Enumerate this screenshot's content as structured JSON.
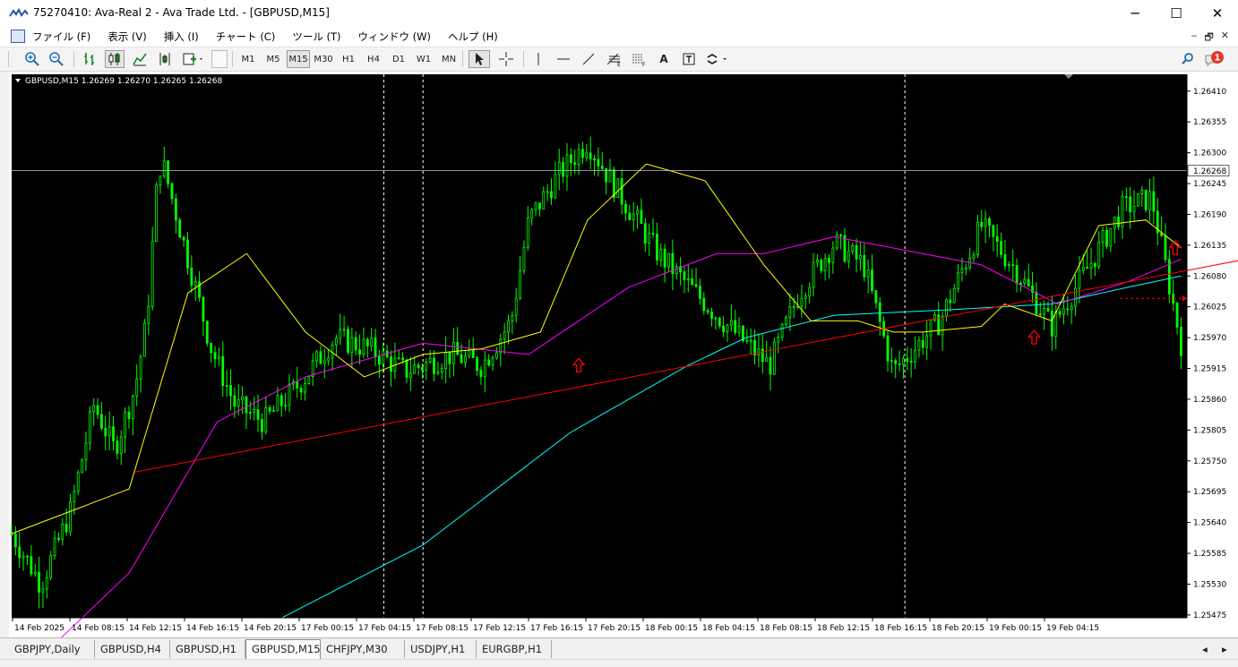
{
  "window": {
    "title": "75270410: Ava-Real 2 - Ava Trade Ltd. - [GBPUSD,M15]",
    "minimize_glyph": "─",
    "maximize_glyph": "☐",
    "close_glyph": "✕"
  },
  "menu": {
    "items": [
      "ファイル (F)",
      "表示 (V)",
      "挿入 (I)",
      "チャート (C)",
      "ツール (T)",
      "ウィンドウ (W)",
      "ヘルプ (H)"
    ],
    "mdi_buttons": [
      "‒",
      "🗗",
      "✕"
    ]
  },
  "toolbar": {
    "periods": [
      "M1",
      "M5",
      "M15",
      "M30",
      "H1",
      "H4",
      "D1",
      "W1",
      "MN"
    ],
    "active_period": "M15",
    "text_tool_label": "A",
    "notification_count": "1",
    "icons": [
      "zoom-in-icon",
      "zoom-out-icon",
      "bar-chart-icon",
      "candle-chart-icon",
      "line-chart-icon",
      "autoscroll-icon",
      "indicator-add-icon",
      "cursor-icon",
      "crosshair-icon",
      "vertical-line-icon",
      "horizontal-line-icon",
      "trendline-icon",
      "fibonacci-icon",
      "fibo-fan-icon",
      "text-icon",
      "text-label-icon",
      "arrows-icon",
      "search-icon",
      "notification-icon"
    ]
  },
  "chart": {
    "header_text": "GBPUSD,M15  1.26269 1.26270 1.26265 1.26268",
    "current_price_label": "1.26268",
    "colors": {
      "background": "#000000",
      "candle": "#00ff00",
      "ma_fast": "#ffff00",
      "ma_mid": "#ff00ff",
      "ma_slow": "#00ffff",
      "trendline": "#ff0000",
      "arrow": "#ff0000",
      "grid_separator": "#ffffff"
    }
  },
  "chart_data": {
    "type": "candlestick",
    "symbol": "GBPUSD",
    "timeframe": "M15",
    "ylim": [
      1.2547,
      1.2644
    ],
    "y_ticks": [
      "1.26410",
      "1.26355",
      "1.26300",
      "1.26245",
      "1.26190",
      "1.26135",
      "1.26080",
      "1.26025",
      "1.25970",
      "1.25915",
      "1.25860",
      "1.25805",
      "1.25750",
      "1.25695",
      "1.25640",
      "1.25585",
      "1.25530",
      "1.25475"
    ],
    "x_ticks": [
      "14 Feb 2025",
      "14 Feb 08:15",
      "14 Feb 12:15",
      "14 Feb 16:15",
      "14 Feb 20:15",
      "17 Feb 00:15",
      "17 Feb 04:15",
      "17 Feb 08:15",
      "17 Feb 12:15",
      "17 Feb 16:15",
      "17 Feb 20:15",
      "18 Feb 00:15",
      "18 Feb 04:15",
      "18 Feb 08:15",
      "18 Feb 12:15",
      "18 Feb 16:15",
      "18 Feb 20:15",
      "19 Feb 00:15",
      "19 Feb 04:15"
    ],
    "bar_count": 300,
    "price_path": [
      [
        0,
        1.2562
      ],
      [
        10,
        1.2553
      ],
      [
        20,
        1.2566
      ],
      [
        28,
        1.2585
      ],
      [
        35,
        1.2577
      ],
      [
        42,
        1.2588
      ],
      [
        46,
        1.26
      ],
      [
        50,
        1.2628
      ],
      [
        52,
        1.2627
      ],
      [
        58,
        1.2615
      ],
      [
        68,
        1.2595
      ],
      [
        76,
        1.2585
      ],
      [
        86,
        1.2582
      ],
      [
        100,
        1.259
      ],
      [
        110,
        1.2597
      ],
      [
        122,
        1.2595
      ],
      [
        134,
        1.2591
      ],
      [
        150,
        1.2594
      ],
      [
        160,
        1.2592
      ],
      [
        170,
        1.26
      ],
      [
        176,
        1.2618
      ],
      [
        186,
        1.2626
      ],
      [
        196,
        1.2632
      ],
      [
        204,
        1.2625
      ],
      [
        220,
        1.2612
      ],
      [
        240,
        1.2601
      ],
      [
        258,
        1.2592
      ],
      [
        268,
        1.2605
      ],
      [
        280,
        1.2614
      ],
      [
        290,
        1.261
      ],
      [
        300,
        1.2591
      ],
      [
        316,
        1.26
      ],
      [
        330,
        1.2617
      ],
      [
        342,
        1.2609
      ],
      [
        354,
        1.2599
      ],
      [
        368,
        1.2611
      ],
      [
        378,
        1.262
      ],
      [
        388,
        1.2622
      ],
      [
        398,
        1.2596
      ]
    ],
    "ma_fast_path": [
      [
        0,
        1.2562
      ],
      [
        40,
        1.257
      ],
      [
        60,
        1.2605
      ],
      [
        80,
        1.2612
      ],
      [
        100,
        1.2598
      ],
      [
        120,
        1.259
      ],
      [
        140,
        1.2594
      ],
      [
        160,
        1.2595
      ],
      [
        180,
        1.2598
      ],
      [
        196,
        1.2618
      ],
      [
        216,
        1.2628
      ],
      [
        236,
        1.2625
      ],
      [
        256,
        1.261
      ],
      [
        272,
        1.26
      ],
      [
        288,
        1.26
      ],
      [
        300,
        1.2598
      ],
      [
        310,
        1.2598
      ],
      [
        330,
        1.2599
      ],
      [
        338,
        1.2603
      ],
      [
        354,
        1.26
      ],
      [
        370,
        1.2617
      ],
      [
        386,
        1.2618
      ],
      [
        398,
        1.2613
      ]
    ],
    "ma_mid_path": [
      [
        0,
        1.2535
      ],
      [
        40,
        1.2555
      ],
      [
        70,
        1.2582
      ],
      [
        100,
        1.259
      ],
      [
        140,
        1.2596
      ],
      [
        176,
        1.2594
      ],
      [
        210,
        1.2606
      ],
      [
        240,
        1.2612
      ],
      [
        256,
        1.2612
      ],
      [
        280,
        1.2615
      ],
      [
        300,
        1.2613
      ],
      [
        330,
        1.261
      ],
      [
        356,
        1.2603
      ],
      [
        380,
        1.2607
      ],
      [
        398,
        1.2611
      ]
    ],
    "ma_slow_path": [
      [
        92,
        1.2547
      ],
      [
        140,
        1.256
      ],
      [
        190,
        1.258
      ],
      [
        230,
        1.2592
      ],
      [
        250,
        1.2597
      ],
      [
        280,
        1.2601
      ],
      [
        320,
        1.2602
      ],
      [
        354,
        1.2603
      ],
      [
        380,
        1.2606
      ],
      [
        398,
        1.2608
      ]
    ],
    "trendline": [
      [
        42,
        1.2573
      ],
      [
        430,
        1.2612
      ]
    ],
    "arrow_marks": [
      [
        193,
        1.2592
      ],
      [
        348,
        1.2597
      ],
      [
        396,
        1.2613
      ]
    ],
    "separator_bars": [
      95,
      105,
      228,
      352
    ],
    "current_price": 1.26268
  },
  "tabs": {
    "items": [
      "GBPJPY,Daily",
      "GBPUSD,H4",
      "GBPUSD,H1",
      "GBPUSD,M15",
      "CHFJPY,M30",
      "USDJPY,H1",
      "EURGBP,H1"
    ],
    "active": "GBPUSD,M15",
    "scroll_left": "◂",
    "scroll_right": "▸"
  }
}
